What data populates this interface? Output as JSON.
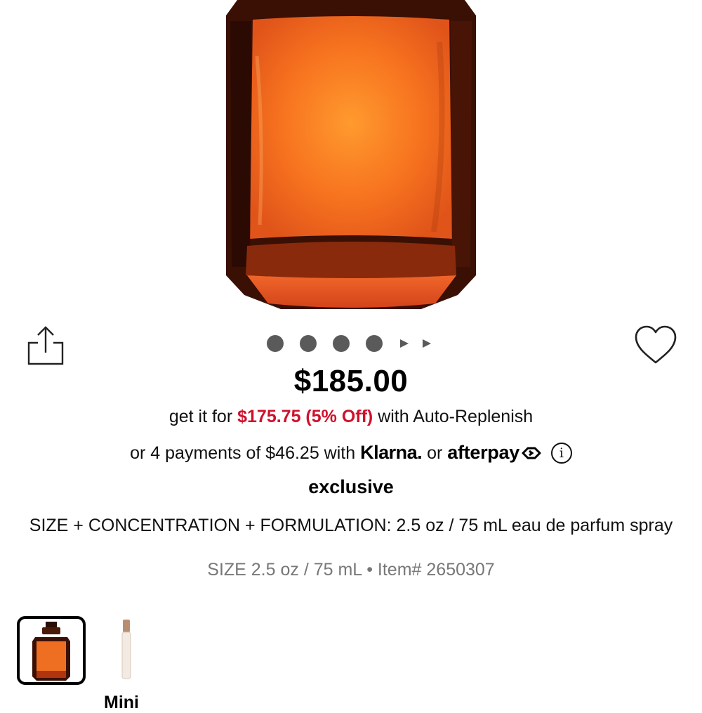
{
  "product": {
    "price": "$185.00",
    "auto_replenish": {
      "prefix": "get it for",
      "discount_price": "$175.75 (5% Off)",
      "suffix": "with Auto-Replenish"
    },
    "payments": {
      "prefix": "or 4 payments of $46.25 with",
      "klarna": "Klarna.",
      "or": "or",
      "afterpay": "afterpay",
      "info": "i"
    },
    "badge": "exclusive",
    "spec": "SIZE + CONCENTRATION + FORMULATION: 2.5 oz / 75 mL eau de parfum spray",
    "meta": "SIZE 2.5 oz / 75 mL • Item# 2650307"
  },
  "gallery": {
    "image_count_dots": 4,
    "dot_color": "#5a5a5a"
  },
  "variants": [
    {
      "label": "",
      "selected": true
    },
    {
      "label": "Mini",
      "selected": false
    }
  ],
  "icons": {
    "share": "share-icon",
    "favorite": "heart-icon",
    "info": "info-icon"
  },
  "colors": {
    "discount_red": "#cf112c",
    "bottle_orange": "#f07a26",
    "bottle_dark": "#3d1206"
  }
}
